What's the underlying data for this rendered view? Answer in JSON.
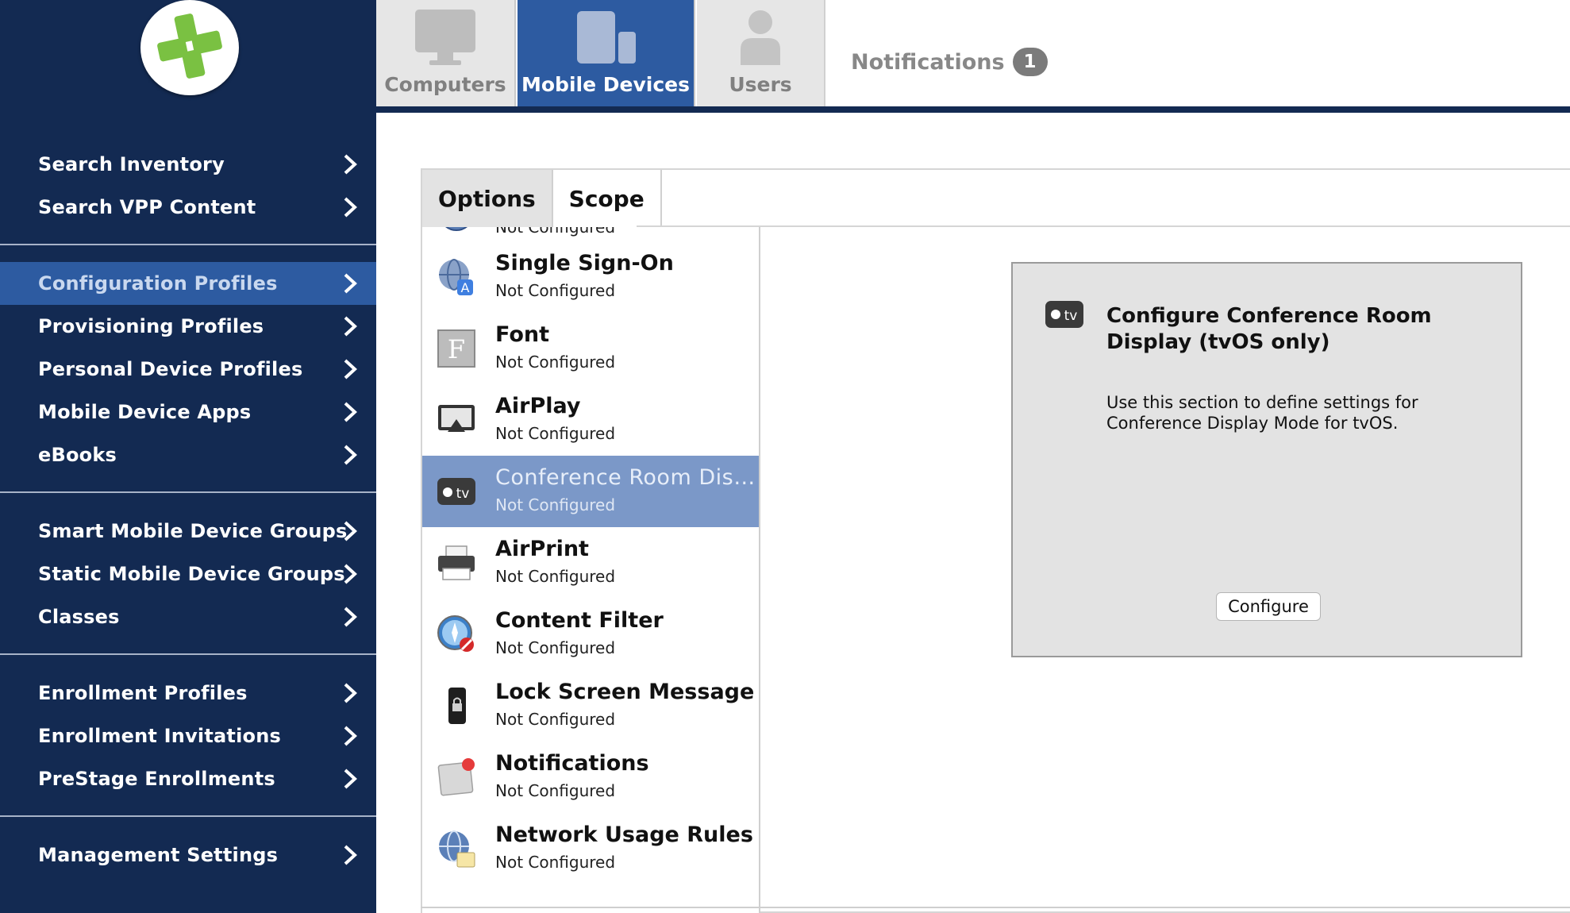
{
  "sidebar": {
    "groups": [
      {
        "items": [
          {
            "label": "Search Inventory"
          },
          {
            "label": "Search VPP Content"
          }
        ]
      },
      {
        "items": [
          {
            "label": "Configuration Profiles",
            "active": true
          },
          {
            "label": "Provisioning Profiles"
          },
          {
            "label": "Personal Device Profiles"
          },
          {
            "label": "Mobile Device Apps"
          },
          {
            "label": "eBooks"
          }
        ]
      },
      {
        "items": [
          {
            "label": "Smart Mobile Device Groups"
          },
          {
            "label": "Static Mobile Device Groups"
          },
          {
            "label": "Classes"
          }
        ]
      },
      {
        "items": [
          {
            "label": "Enrollment Profiles"
          },
          {
            "label": "Enrollment Invitations"
          },
          {
            "label": "PreStage Enrollments"
          }
        ]
      },
      {
        "items": [
          {
            "label": "Management Settings"
          }
        ]
      }
    ]
  },
  "top_tabs": [
    {
      "label": "Computers",
      "icon": "monitor-icon"
    },
    {
      "label": "Mobile Devices",
      "icon": "mobile-devices-icon",
      "active": true
    },
    {
      "label": "Users",
      "icon": "user-icon"
    }
  ],
  "notifications": {
    "label": "Notifications",
    "count": "1"
  },
  "subtabs": [
    {
      "label": "Options",
      "active": true
    },
    {
      "label": "Scope"
    }
  ],
  "payloads": [
    {
      "title": "",
      "status": "Not Configured",
      "icon": "globe-icon"
    },
    {
      "title": "Single Sign-On",
      "status": "Not Configured",
      "icon": "single-sign-on-icon"
    },
    {
      "title": "Font",
      "status": "Not Configured",
      "icon": "font-icon"
    },
    {
      "title": "AirPlay",
      "status": "Not Configured",
      "icon": "airplay-icon"
    },
    {
      "title": "Conference Room Dis…",
      "status": "Not Configured",
      "icon": "apple-tv-icon",
      "active": true
    },
    {
      "title": "AirPrint",
      "status": "Not Configured",
      "icon": "printer-icon"
    },
    {
      "title": "Content Filter",
      "status": "Not Configured",
      "icon": "content-filter-icon"
    },
    {
      "title": "Lock Screen Message",
      "status": "Not Configured",
      "icon": "lock-screen-icon"
    },
    {
      "title": "Notifications",
      "status": "Not Configured",
      "icon": "notifications-icon"
    },
    {
      "title": "Network Usage Rules",
      "status": "Not Configured",
      "icon": "network-usage-icon"
    }
  ],
  "config_panel": {
    "title": "Configure Conference Room Display (tvOS only)",
    "description": "Use this section to define settings for Conference Display Mode for tvOS.",
    "button_label": "Configure",
    "icon": "apple-tv-icon"
  },
  "colors": {
    "sidebar_bg": "#132a52",
    "active_blue": "#2d5ba1",
    "selected_row": "#7b98c8",
    "logo_green": "#7ac142"
  }
}
